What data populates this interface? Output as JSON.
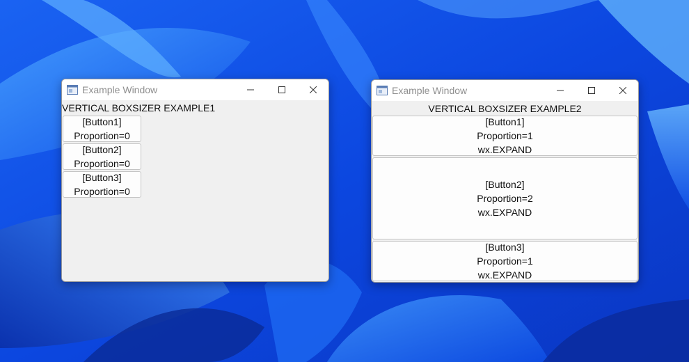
{
  "desktop": {
    "wallpaper_color": "#0b3fd8"
  },
  "window1": {
    "title": "Example Window",
    "heading": "VERTICAL BOXSIZER EXAMPLE1",
    "buttons": [
      {
        "line1": "[Button1]",
        "line2": "Proportion=0"
      },
      {
        "line1": "[Button2]",
        "line2": "Proportion=0"
      },
      {
        "line1": "[Button3]",
        "line2": "Proportion=0"
      }
    ]
  },
  "window2": {
    "title": "Example Window",
    "heading": "VERTICAL BOXSIZER EXAMPLE2",
    "buttons": [
      {
        "line1": "[Button1]",
        "line2": "Proportion=1",
        "line3": "wx.EXPAND"
      },
      {
        "line1": "[Button2]",
        "line2": "Proportion=2",
        "line3": "wx.EXPAND"
      },
      {
        "line1": "[Button3]",
        "line2": "Proportion=1",
        "line3": "wx.EXPAND"
      }
    ]
  },
  "icons": {
    "app": "window-app-icon",
    "minimize": "minimize-icon",
    "maximize": "maximize-icon",
    "close": "close-icon"
  }
}
